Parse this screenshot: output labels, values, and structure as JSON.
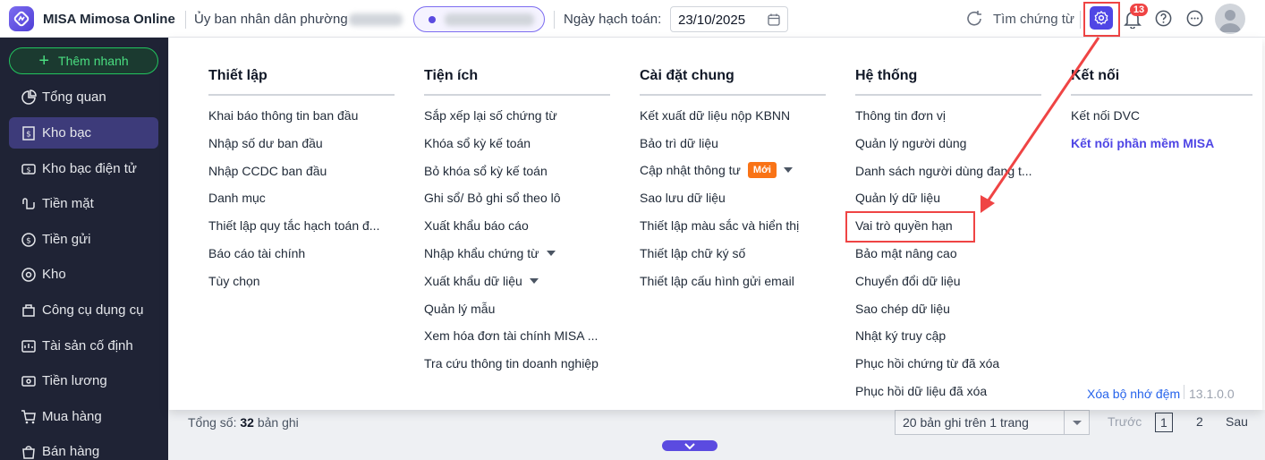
{
  "header": {
    "app_title": "MISA Mimosa Online",
    "org_name": "Ủy ban nhân dân phường",
    "date_label": "Ngày hạch toán:",
    "date_value": "23/10/2025",
    "search_label": "Tìm chứng từ",
    "notification_count": "13"
  },
  "sidebar": {
    "quick_add": "Thêm nhanh",
    "items": [
      {
        "label": "Tổng quan"
      },
      {
        "label": "Kho bạc"
      },
      {
        "label": "Kho bạc điện tử"
      },
      {
        "label": "Tiền mặt"
      },
      {
        "label": "Tiền gửi"
      },
      {
        "label": "Kho"
      },
      {
        "label": "Công cụ dụng cụ"
      },
      {
        "label": "Tài sản cố định"
      },
      {
        "label": "Tiền lương"
      },
      {
        "label": "Mua hàng"
      },
      {
        "label": "Bán hàng"
      }
    ]
  },
  "menu": {
    "columns": [
      {
        "title": "Thiết lập",
        "items": [
          "Khai báo thông tin ban đầu",
          "Nhập số dư ban đầu",
          "Nhập CCDC ban đầu",
          "Danh mục",
          "Thiết lập quy tắc hạch toán đ...",
          "Báo cáo tài chính",
          "Tùy chọn"
        ]
      },
      {
        "title": "Tiện ích",
        "items": [
          "Sắp xếp lại số chứng từ",
          "Khóa sổ kỳ kế toán",
          "Bỏ khóa sổ kỳ kế toán",
          "Ghi sổ/ Bỏ ghi sổ theo lô",
          "Xuất khẩu báo cáo",
          "Nhập khẩu chứng từ",
          "Xuất khẩu dữ liệu",
          "Quản lý mẫu",
          "Xem hóa đơn tài chính MISA ...",
          "Tra cứu thông tin doanh nghiệp"
        ]
      },
      {
        "title": "Cài đặt chung",
        "items": [
          "Kết xuất dữ liệu nộp KBNN",
          "Bảo trì dữ liệu",
          "Cập nhật thông tư",
          "Sao lưu dữ liệu",
          "Thiết lập màu sắc và hiển thị",
          "Thiết lập chữ ký số",
          "Thiết lập cấu hình gửi email"
        ],
        "new_badge": "Mới"
      },
      {
        "title": "Hệ thống",
        "items": [
          "Thông tin đơn vị",
          "Quản lý người dùng",
          "Danh sách người dùng đang t...",
          "Quản lý dữ liệu",
          "Vai trò quyền hạn",
          "Bảo mật nâng cao",
          "Chuyển đổi dữ liệu",
          "Sao chép dữ liệu",
          "Nhật ký truy cập",
          "Phục hồi chứng từ đã xóa",
          "Phục hồi dữ liệu đã xóa"
        ]
      },
      {
        "title": "Kết nối",
        "items": [
          "Kết nối DVC",
          "Kết nối phần mềm MISA"
        ]
      }
    ],
    "clear_cache": "Xóa bộ nhớ đệm",
    "version": "13.1.0.0"
  },
  "background": {
    "total_prefix": "Tổng số:",
    "total_count": "32",
    "total_suffix": "bản ghi",
    "page_size": "20 bản ghi trên 1 trang",
    "prev": "Trước",
    "page1": "1",
    "page2": "2",
    "next": "Sau"
  },
  "colors": {
    "accent": "#4f46e5",
    "sidebar_bg": "#1f2335",
    "highlight": "#ef4444",
    "new_badge": "#f97316"
  }
}
